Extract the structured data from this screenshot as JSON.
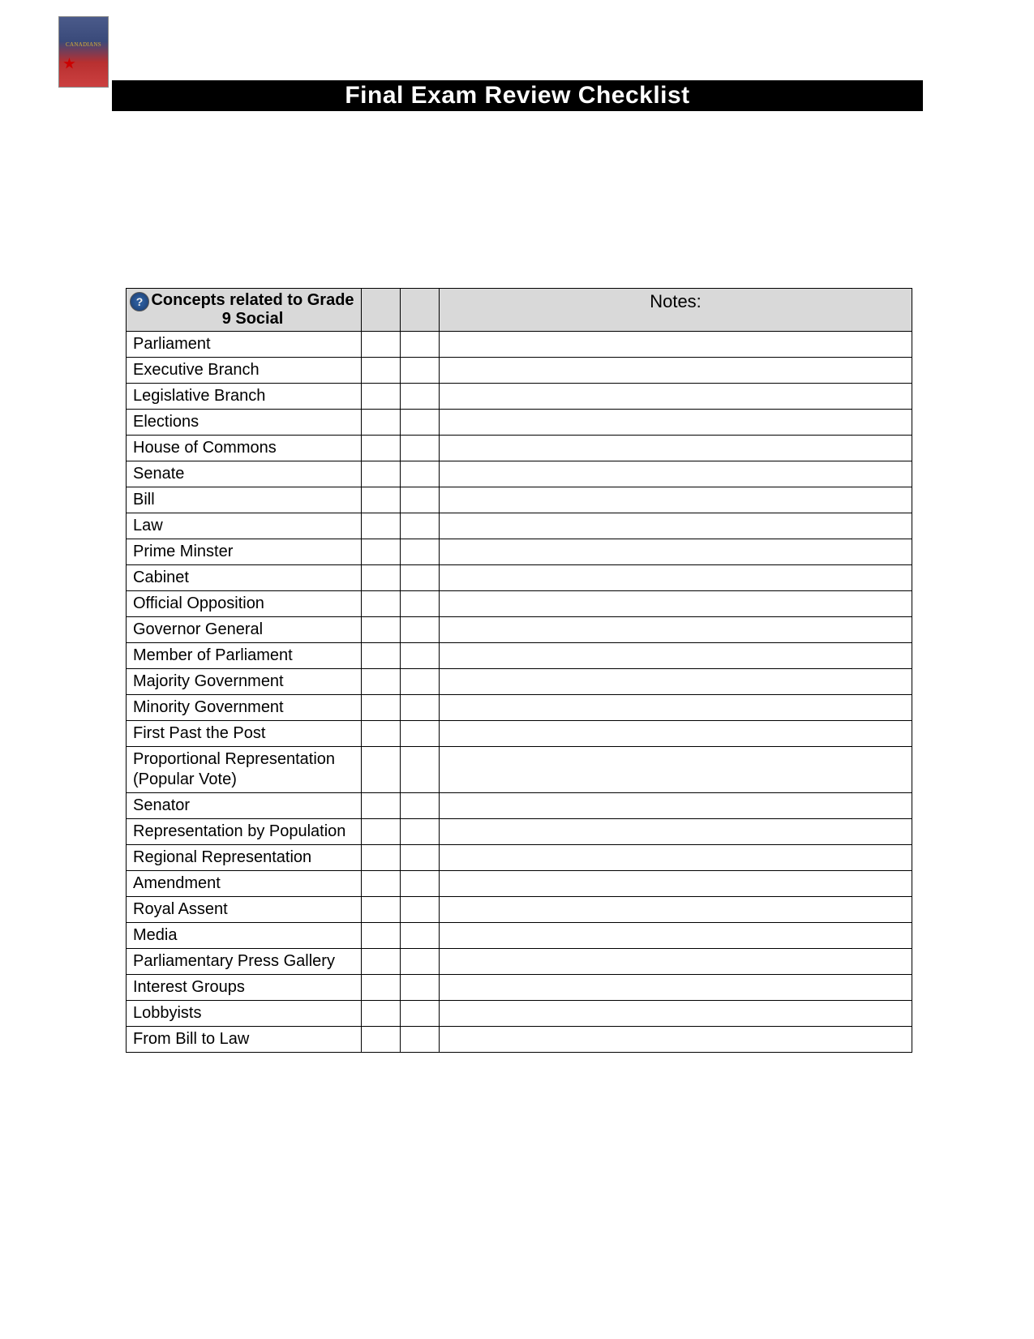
{
  "title": "Final Exam Review Checklist",
  "table": {
    "header": {
      "concepts": "Concepts related to Grade 9 Social",
      "notes": "Notes:"
    },
    "rows": [
      {
        "concept": "Parliament"
      },
      {
        "concept": "Executive Branch"
      },
      {
        "concept": "Legislative Branch"
      },
      {
        "concept": "Elections"
      },
      {
        "concept": "House of Commons"
      },
      {
        "concept": "Senate"
      },
      {
        "concept": "Bill"
      },
      {
        "concept": "Law"
      },
      {
        "concept": "Prime Minster"
      },
      {
        "concept": "Cabinet"
      },
      {
        "concept": "Official Opposition"
      },
      {
        "concept": "Governor General"
      },
      {
        "concept": "Member of Parliament"
      },
      {
        "concept": "Majority Government"
      },
      {
        "concept": "Minority Government"
      },
      {
        "concept": "First Past the Post"
      },
      {
        "concept": "Proportional Representation (Popular Vote)"
      },
      {
        "concept": "Senator"
      },
      {
        "concept": "Representation by Population"
      },
      {
        "concept": "Regional Representation"
      },
      {
        "concept": "Amendment"
      },
      {
        "concept": "Royal Assent"
      },
      {
        "concept": "Media"
      },
      {
        "concept": "Parliamentary Press Gallery"
      },
      {
        "concept": "Interest Groups"
      },
      {
        "concept": "Lobbyists"
      },
      {
        "concept": "From Bill to Law"
      }
    ]
  }
}
